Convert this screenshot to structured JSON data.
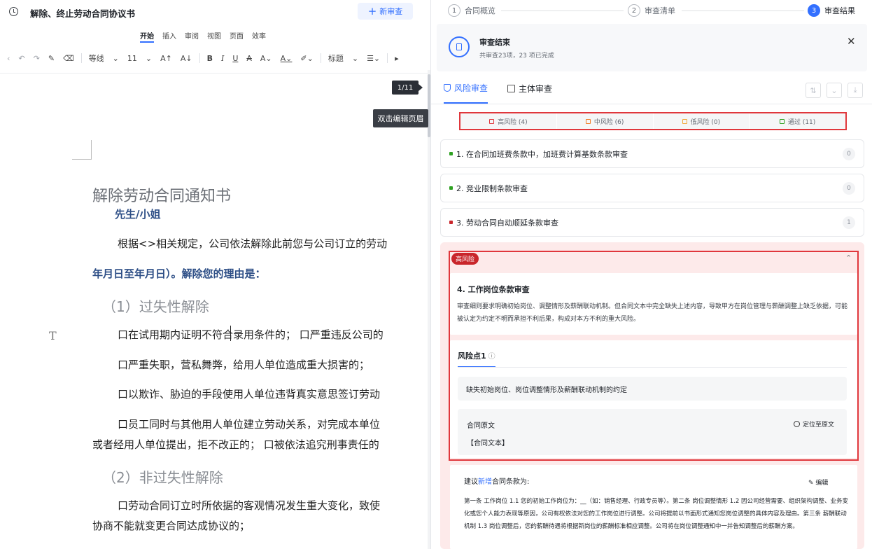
{
  "editor": {
    "doc_title": "解除、终止劳动合同协议书",
    "new_review_label": "新审查",
    "ribbon_tabs": [
      "开始",
      "插入",
      "审阅",
      "视图",
      "页面",
      "效率"
    ],
    "toolbar": {
      "font_name": "等线",
      "font_size": "11",
      "style": "标题"
    },
    "page_indicator": "1/11",
    "header_tip": "双击编辑页眉",
    "document": {
      "heading": "解除劳动合同通知书",
      "salutation": "先生/小姐",
      "para1": "根据<>相关规定，公司依法解除此前您与公司订立的劳动",
      "para1_cont": "年月日至年月日）。解除您的理由是：",
      "section1": "（1）过失性解除",
      "l1": "口在试用期内证明不符合录用条件的；  口严重违反公司的",
      "l2": "口严重失职，营私舞弊，给用人单位造成重大损害的；",
      "l3": "口以欺诈、胁迫的手段使用人单位违背真实意思签订劳动",
      "l4": "口员工同时与其他用人单位建立劳动关系，对完成本单位",
      "l4_cont": "或者经用人单位提出，拒不改正的；  口被依法追究刑事责任的",
      "section2": "（2）非过失性解除",
      "l5": "口劳动合同订立时所依据的客观情况发生重大变化，致使",
      "l5_cont": "协商不能就变更合同达成协议的；"
    }
  },
  "review": {
    "steps": [
      {
        "num": "1",
        "label": "合同概览"
      },
      {
        "num": "2",
        "label": "审查清单"
      },
      {
        "num": "3",
        "label": "审查结果"
      }
    ],
    "result_title": "审查结束",
    "result_sub": "共审查23项，23 项已完成",
    "tabs": {
      "risk": "风险审查",
      "entity": "主体审查"
    },
    "filters": [
      {
        "label": "高风险 (4)",
        "color": "#e0373c"
      },
      {
        "label": "中风险 (6)",
        "color": "#f07b22"
      },
      {
        "label": "低风险 (0)",
        "color": "#f2a93b"
      },
      {
        "label": "通过 (11)",
        "color": "#2ea121"
      }
    ],
    "items": [
      {
        "label": "1. 在合同加班费条款中，加班费计算基数条款审查",
        "count": "0",
        "color": "#2ea121"
      },
      {
        "label": "2. 竞业限制条款审查",
        "count": "0",
        "color": "#2ea121"
      },
      {
        "label": "3. 劳动合同自动顺延条款审查",
        "count": "1",
        "color": "#c9262b"
      }
    ],
    "expanded": {
      "badge": "高风险",
      "title": "4. 工作岗位条款审查",
      "desc": "审查细则要求明确初始岗位、调整情形及薪酬联动机制。但合同文本中完全缺失上述内容，导致甲方在岗位管理与薪酬调整上缺乏依据，可能被认定为约定不明而承担不利后果，构成对本方不利的重大风险。",
      "risk_point_tab": "风险点1",
      "risk_point_desc": "缺失初始岗位、岗位调整情形及薪酬联动机制的约定",
      "original_label": "合同原文",
      "locate_label": "定位至原文",
      "original_text": "【合同文本】",
      "suggest_prefix": "建议",
      "suggest_highlight": "新增",
      "suggest_suffix": "合同条款为:",
      "edit_label": "编辑",
      "suggest_body": "第一条 工作岗位 1.1 您的初始工作岗位为：__（如：销售经理、行政专员等）。第二条 岗位调整情形 1.2 因公司经营需要、组织架构调整、业务变化或您个人能力表现等原因，公司有权依法对您的工作岗位进行调整。公司将提前以书面形式通知您岗位调整的具体内容及理由。第三条 薪酬联动机制 1.3 岗位调整后，您的薪酬待遇将根据新岗位的薪酬标准相应调整。公司将在岗位调整通知中一并告知调整后的薪酬方案。"
    }
  }
}
